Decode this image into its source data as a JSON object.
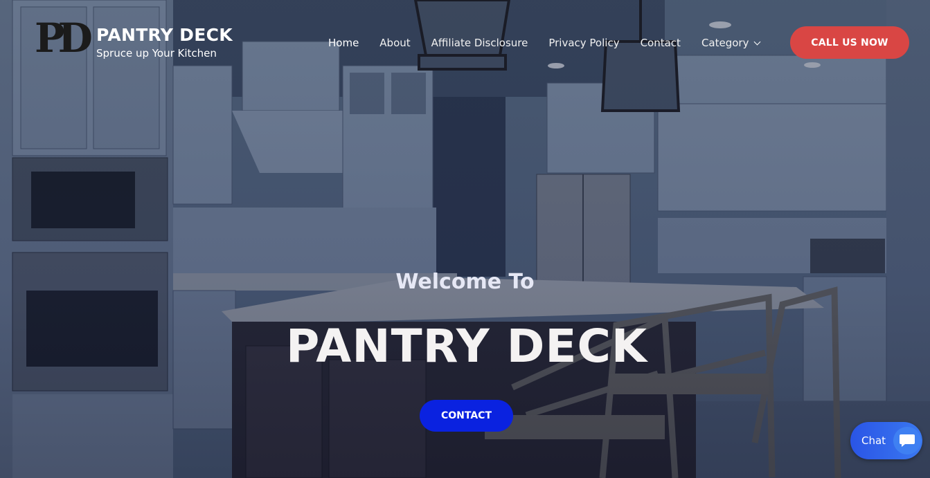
{
  "brand": {
    "logo_letters": "PD",
    "title": "PANTRY DECK",
    "tagline": "Spruce up Your Kitchen"
  },
  "nav": {
    "items": [
      {
        "label": "Home",
        "active": true
      },
      {
        "label": "About"
      },
      {
        "label": "Affiliate Disclosure"
      },
      {
        "label": "Privacy Policy"
      },
      {
        "label": "Contact"
      },
      {
        "label": "Category",
        "icon": "chevron-down-icon"
      }
    ]
  },
  "header": {
    "cta_label": "CALL US NOW"
  },
  "hero": {
    "welcome": "Welcome To",
    "title": "PANTRY DECK",
    "button_label": "CONTACT",
    "background": "kitchen-photo"
  },
  "chat": {
    "label": "Chat",
    "icon": "chat-bubble-icon"
  },
  "colors": {
    "cta_red": "#d94644",
    "contact_blue": "#0a22e0",
    "chat_blue": "#2a55e6"
  }
}
